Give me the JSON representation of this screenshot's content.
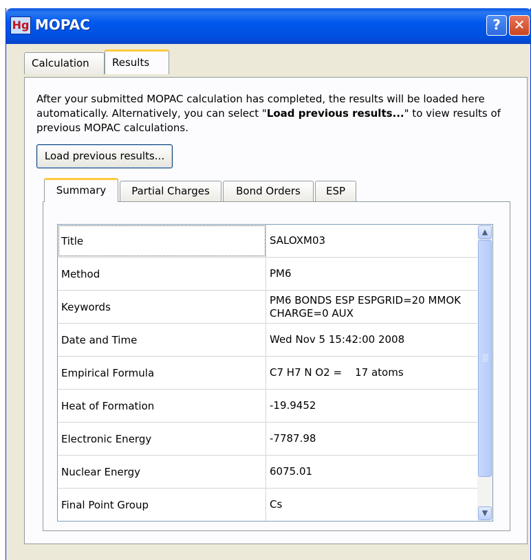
{
  "window": {
    "title": "MOPAC",
    "icon_label": "Hg",
    "help_label": "?",
    "close_label": "✕"
  },
  "main_tabs": [
    {
      "label": "Calculation",
      "active": false
    },
    {
      "label": "Results",
      "active": true
    }
  ],
  "results": {
    "description_1": "After your submitted MOPAC calculation has completed, the results will be loaded here automatically. Alternatively, you can select \"",
    "description_bold": "Load previous results...",
    "description_2": "\" to view results of previous MOPAC calculations.",
    "load_button": "Load previous results..."
  },
  "sub_tabs": [
    {
      "label": "Summary",
      "active": true
    },
    {
      "label": "Partial Charges",
      "active": false
    },
    {
      "label": "Bond Orders",
      "active": false
    },
    {
      "label": "ESP",
      "active": false
    }
  ],
  "summary": [
    {
      "key": "Title",
      "value": "SALOXM03"
    },
    {
      "key": "Method",
      "value": "PM6"
    },
    {
      "key": "Keywords",
      "value": "PM6 BONDS ESP ESPGRID=20 MMOK CHARGE=0 AUX"
    },
    {
      "key": "Date and Time",
      "value": "Wed Nov  5 15:42:00 2008"
    },
    {
      "key": "Empirical Formula",
      "value": "C7 H7 N O2 =    17 atoms"
    },
    {
      "key": "Heat of Formation",
      "value": "-19.9452"
    },
    {
      "key": "Electronic Energy",
      "value": "-7787.98"
    },
    {
      "key": "Nuclear Energy",
      "value": "6075.01"
    },
    {
      "key": "Final Point Group",
      "value": "Cs"
    }
  ],
  "scrollbar": {
    "up_icon": "▲",
    "down_icon": "▼"
  }
}
